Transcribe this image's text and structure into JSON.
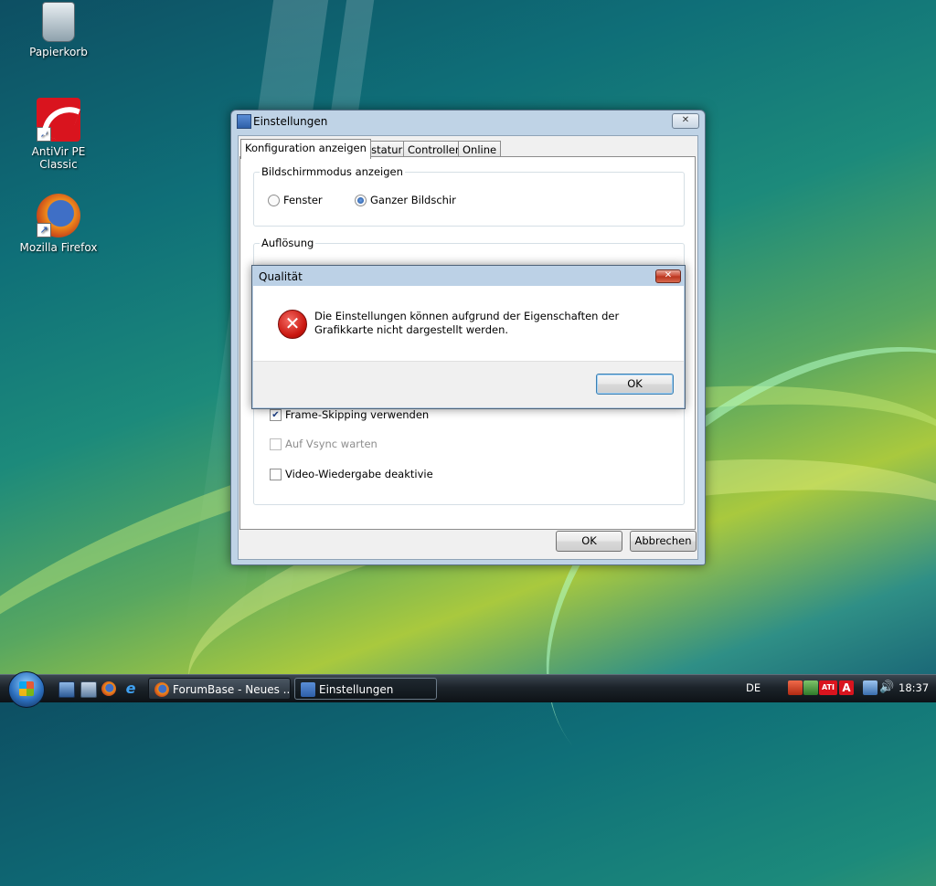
{
  "desktop": {
    "icons": [
      {
        "label": "Papierkorb",
        "icon": "recycle-bin-icon"
      },
      {
        "label": "AntiVir PE Classic",
        "icon": "avira-icon"
      },
      {
        "label": "Mozilla Firefox",
        "icon": "firefox-icon"
      }
    ]
  },
  "window": {
    "title": "Einstellungen",
    "tabs": [
      {
        "label": "Konfiguration anzeigen",
        "active": true
      },
      {
        "label": "Tastatur"
      },
      {
        "label": "Controller"
      },
      {
        "label": "Online"
      }
    ],
    "display_mode_group": {
      "label": "Bildschirmmodus anzeigen",
      "options": [
        {
          "label": "Fenster",
          "selected": false
        },
        {
          "label": "Ganzer Bildschir",
          "selected": true
        }
      ]
    },
    "resolution_group": {
      "label": "Auflösung"
    },
    "checkboxes": [
      {
        "label": "Frame-Skipping verwenden",
        "checked": true,
        "enabled": true
      },
      {
        "label": "Auf Vsync warten",
        "checked": false,
        "enabled": false
      },
      {
        "label": "Video-Wiedergabe deaktivie",
        "checked": false,
        "enabled": true
      }
    ],
    "ok_label": "OK",
    "cancel_label": "Abbrechen"
  },
  "dialog": {
    "title": "Qualität",
    "icon": "error-icon",
    "message": "Die Einstellungen können aufgrund der Eigenschaften der Grafikkarte nicht dargestellt werden.",
    "ok_label": "OK"
  },
  "taskbar": {
    "buttons": [
      {
        "label": "ForumBase - Neues ...",
        "icon": "firefox-icon",
        "active": false
      },
      {
        "label": "Einstellungen",
        "icon": "settings-app-icon",
        "active": true
      }
    ],
    "language": "DE",
    "clock": "18:37"
  },
  "colors": {
    "window_frame": "#bfd3e6",
    "error_red": "#c9160f",
    "taskbar": "#1c232a"
  }
}
